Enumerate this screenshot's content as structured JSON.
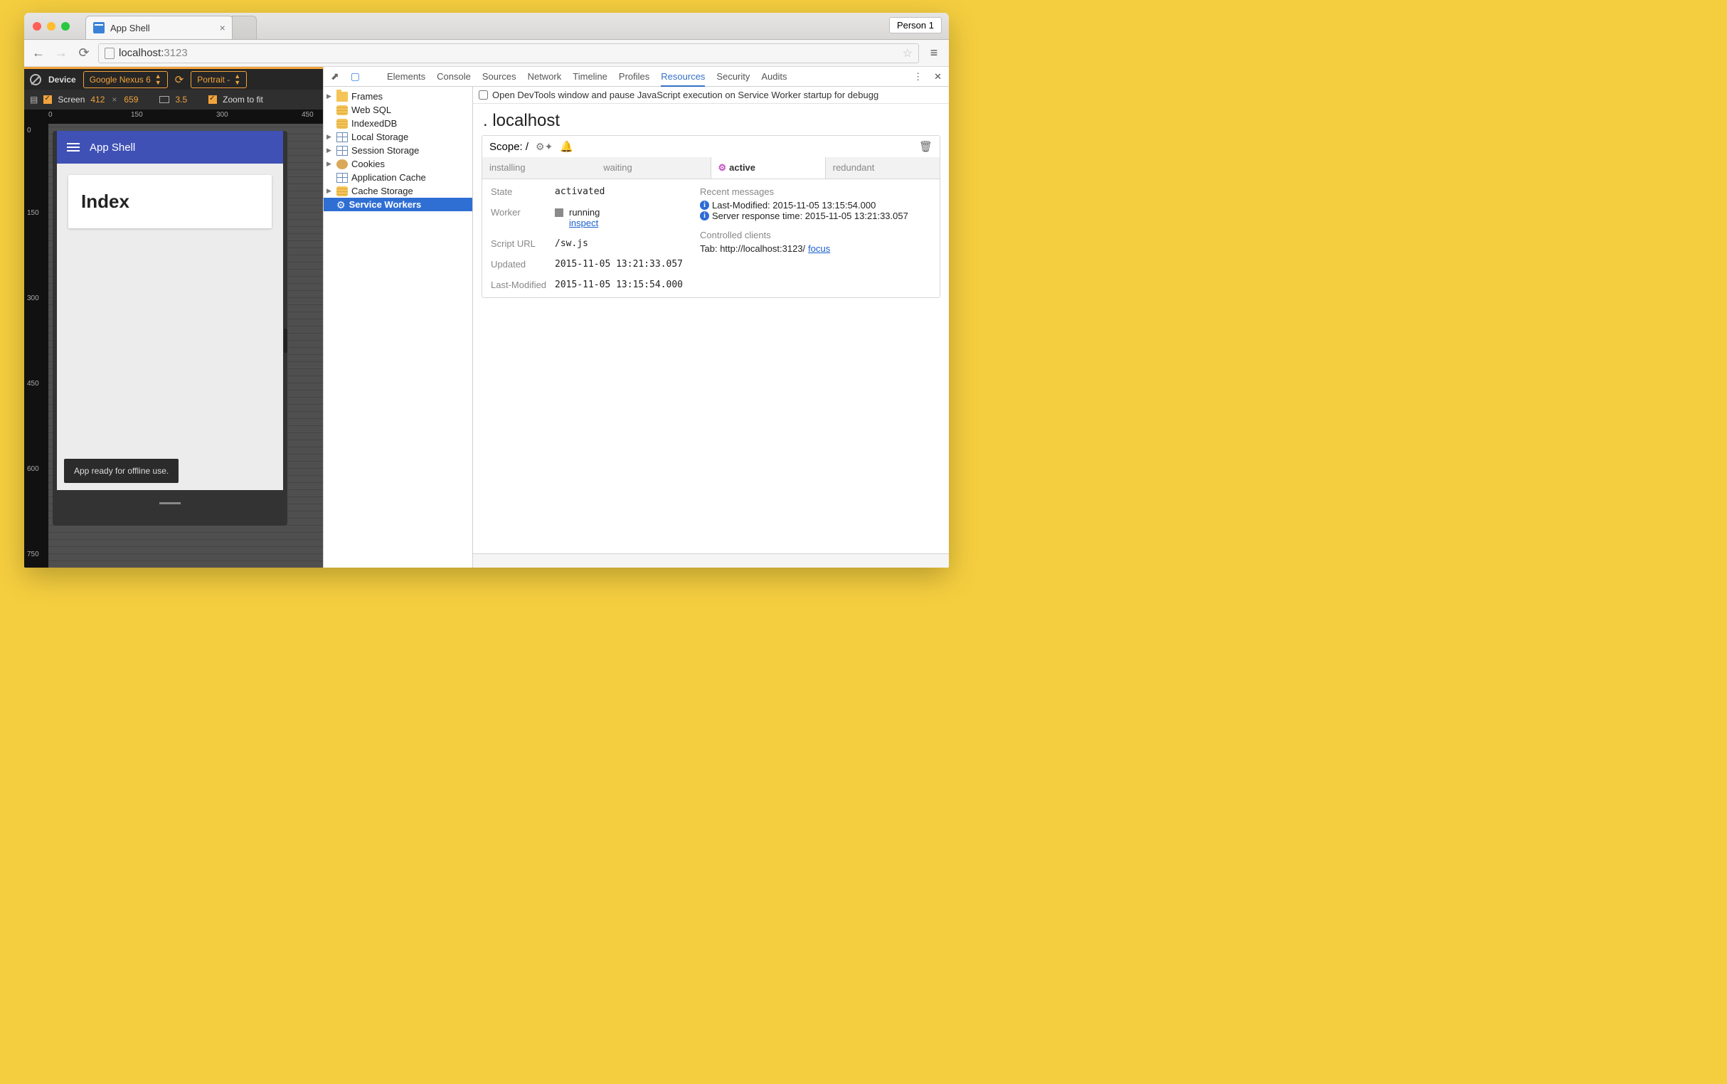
{
  "chrome": {
    "tabTitle": "App Shell",
    "person": "Person 1",
    "urlHost": "localhost:",
    "urlPort": "3123"
  },
  "emulator": {
    "deviceLabel": "Device",
    "device": "Google Nexus 6",
    "orientation": "Portrait ‑",
    "screenLabel": "Screen",
    "width": "412",
    "height": "659",
    "dpr": "3.5",
    "zoomLabel": "Zoom to fit",
    "rulerH": [
      "0",
      "150",
      "300",
      "450"
    ],
    "rulerV": [
      "0",
      "150",
      "300",
      "450",
      "600",
      "750"
    ]
  },
  "app": {
    "title": "App Shell",
    "cardHeading": "Index",
    "toast": "App ready for offline use."
  },
  "devtools": {
    "tabs": [
      "Elements",
      "Console",
      "Sources",
      "Network",
      "Timeline",
      "Profiles",
      "Resources",
      "Security",
      "Audits"
    ],
    "activeTab": "Resources",
    "tree": {
      "frames": "Frames",
      "websql": "Web SQL",
      "indexeddb": "IndexedDB",
      "localstorage": "Local Storage",
      "sessionstorage": "Session Storage",
      "cookies": "Cookies",
      "appcache": "Application Cache",
      "cachestorage": "Cache Storage",
      "serviceworkers": "Service Workers"
    }
  },
  "sw": {
    "banner": "Open DevTools window and pause JavaScript execution on Service Worker startup for debugg",
    "host": "localhost",
    "scopeLabel": "Scope: ",
    "scope": "/",
    "tabs": {
      "installing": "installing",
      "waiting": "waiting",
      "active": "active",
      "redundant": "redundant"
    },
    "labels": {
      "state": "State",
      "worker": "Worker",
      "scriptUrl": "Script URL",
      "updated": "Updated",
      "lastModified": "Last-Modified"
    },
    "values": {
      "state": "activated",
      "workerStatus": "running",
      "inspect": "inspect",
      "scriptUrl": "/sw.js",
      "updated": "2015-11-05 13:21:33.057",
      "lastModified": "2015-11-05 13:15:54.000"
    },
    "right": {
      "recentHeading": "Recent messages",
      "msg1": "Last-Modified: 2015-11-05 13:15:54.000",
      "msg2": "Server response time: 2015-11-05 13:21:33.057",
      "clientsHeading": "Controlled clients",
      "clientLine": "Tab: http://localhost:3123/ ",
      "focus": "focus"
    }
  }
}
